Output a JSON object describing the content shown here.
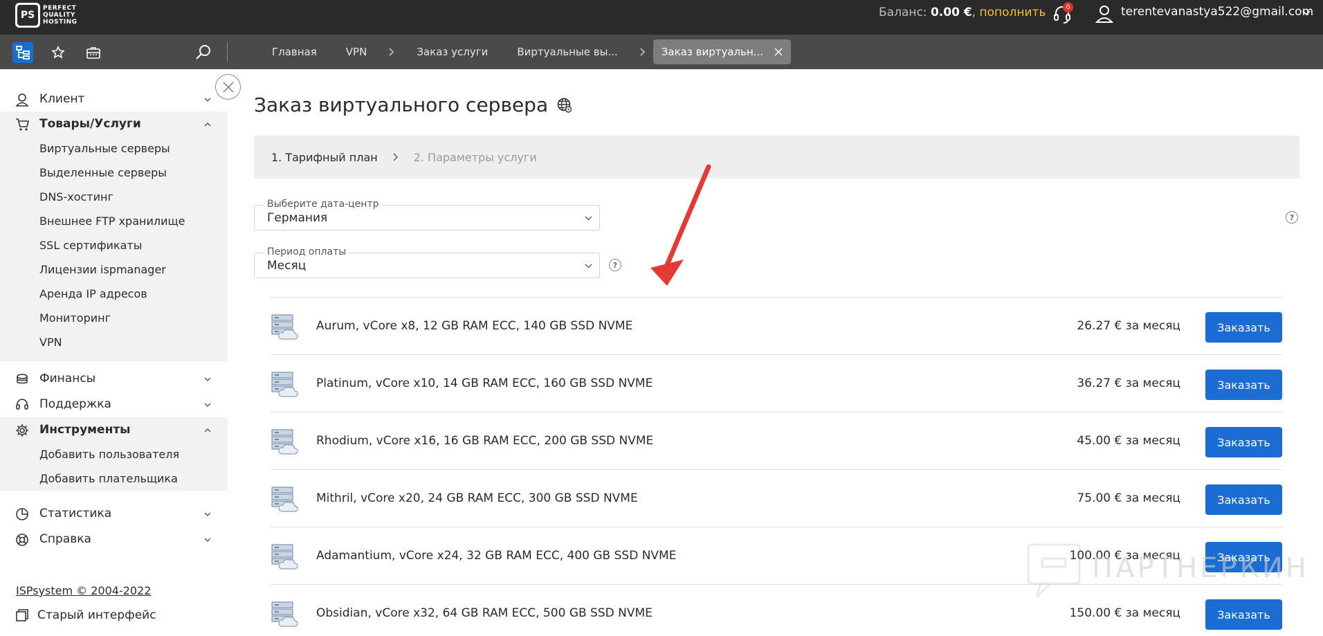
{
  "brand": {
    "logo_mark": "PS",
    "logo_line1": "PERFECT",
    "logo_line2": "QUALITY",
    "logo_line3": "HOSTING"
  },
  "topbar": {
    "balance_label": "Баланс: ",
    "balance_amount": "0.00 €",
    "balance_sep": ", ",
    "topup_label": "пополнить",
    "notifications_count": "0",
    "user_email": "terentevanastya522@gmail.com",
    "badge_color": "#e0312b",
    "topup_color": "#f6c02f"
  },
  "breadcrumbs": [
    {
      "label": "Главная"
    },
    {
      "label": "VPN"
    },
    {
      "label": "Заказ услуги"
    },
    {
      "label": "Виртуальные вы..."
    },
    {
      "label": "Заказ виртуальн..."
    }
  ],
  "sidebar": {
    "groups": [
      {
        "label": "Клиент",
        "icon": "client-icon",
        "expanded": false
      },
      {
        "label": "Товары/Услуги",
        "icon": "cart-icon",
        "expanded": true,
        "items": [
          "Виртуальные серверы",
          "Выделенные серверы",
          "DNS-хостинг",
          "Внешнее FTP хранилище",
          "SSL сертификаты",
          "Лицензии ispmanager",
          "Аренда IP адресов",
          "Мониторинг",
          "VPN"
        ]
      },
      {
        "label": "Финансы",
        "icon": "finance-icon",
        "expanded": false
      },
      {
        "label": "Поддержка",
        "icon": "support-icon",
        "expanded": false
      },
      {
        "label": "Инструменты",
        "icon": "gear-icon",
        "expanded": true,
        "items": [
          "Добавить пользователя",
          "Добавить плательщика"
        ]
      },
      {
        "label": "Статистика",
        "icon": "pie-chart-icon",
        "expanded": false
      },
      {
        "label": "Справка",
        "icon": "lifebuoy-icon",
        "expanded": false
      }
    ],
    "copyright": "ISPsystem © 2004-2022",
    "old_interface": "Старый интерфейс"
  },
  "main": {
    "title": "Заказ виртуального сервера",
    "steps": [
      "1. Тарифный план",
      "2. Параметры услуги"
    ],
    "datacenter": {
      "label": "Выберите дата-центр",
      "value": "Германия"
    },
    "period": {
      "label": "Период оплаты",
      "value": "Месяц"
    },
    "help_glyph": "?",
    "order_label": "Заказать",
    "accent_color": "#1b6dd3",
    "products": [
      {
        "name": "Aurum, vCore x8, 12 GB RAM ECC, 140 GB SSD NVME",
        "price": "26.27 € за месяц"
      },
      {
        "name": "Platinum, vCore x10, 14 GB RAM ECC, 160 GB SSD NVME",
        "price": "36.27 € за месяц"
      },
      {
        "name": "Rhodium, vCore x16, 16 GB RAM ECC, 200 GB SSD NVME",
        "price": "45.00 € за месяц"
      },
      {
        "name": "Mithril, vCore x20, 24 GB RAM ECC, 300 GB SSD NVME",
        "price": "75.00 € за месяц"
      },
      {
        "name": "Adamantium, vCore x24, 32 GB RAM ECC, 400 GB SSD NVME",
        "price": "100.00 € за месяц"
      },
      {
        "name": "Obsidian, vCore x32, 64 GB RAM ECC, 500 GB SSD NVME",
        "price": "150.00 € за месяц"
      }
    ]
  },
  "watermark": "ПАРТНЕРКИН"
}
